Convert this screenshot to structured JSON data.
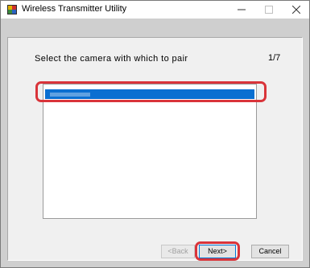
{
  "window": {
    "title": "Wireless Transmitter Utility",
    "controls": {
      "minimize": "–",
      "maximize": "□",
      "close": "✕"
    }
  },
  "wizard": {
    "instruction": "Select the camera with which to pair",
    "page_indicator": "1/7"
  },
  "camera_list": {
    "items": [
      {
        "label": "",
        "selected": true
      }
    ]
  },
  "buttons": {
    "back_label": "<Back",
    "next_label": "Next>",
    "cancel_label": "Cancel"
  },
  "colors": {
    "selection": "#0b6fd1",
    "highlight": "#d9343a",
    "panel_bg": "#f0f0f0",
    "frame_bg": "#cfcfcf"
  }
}
